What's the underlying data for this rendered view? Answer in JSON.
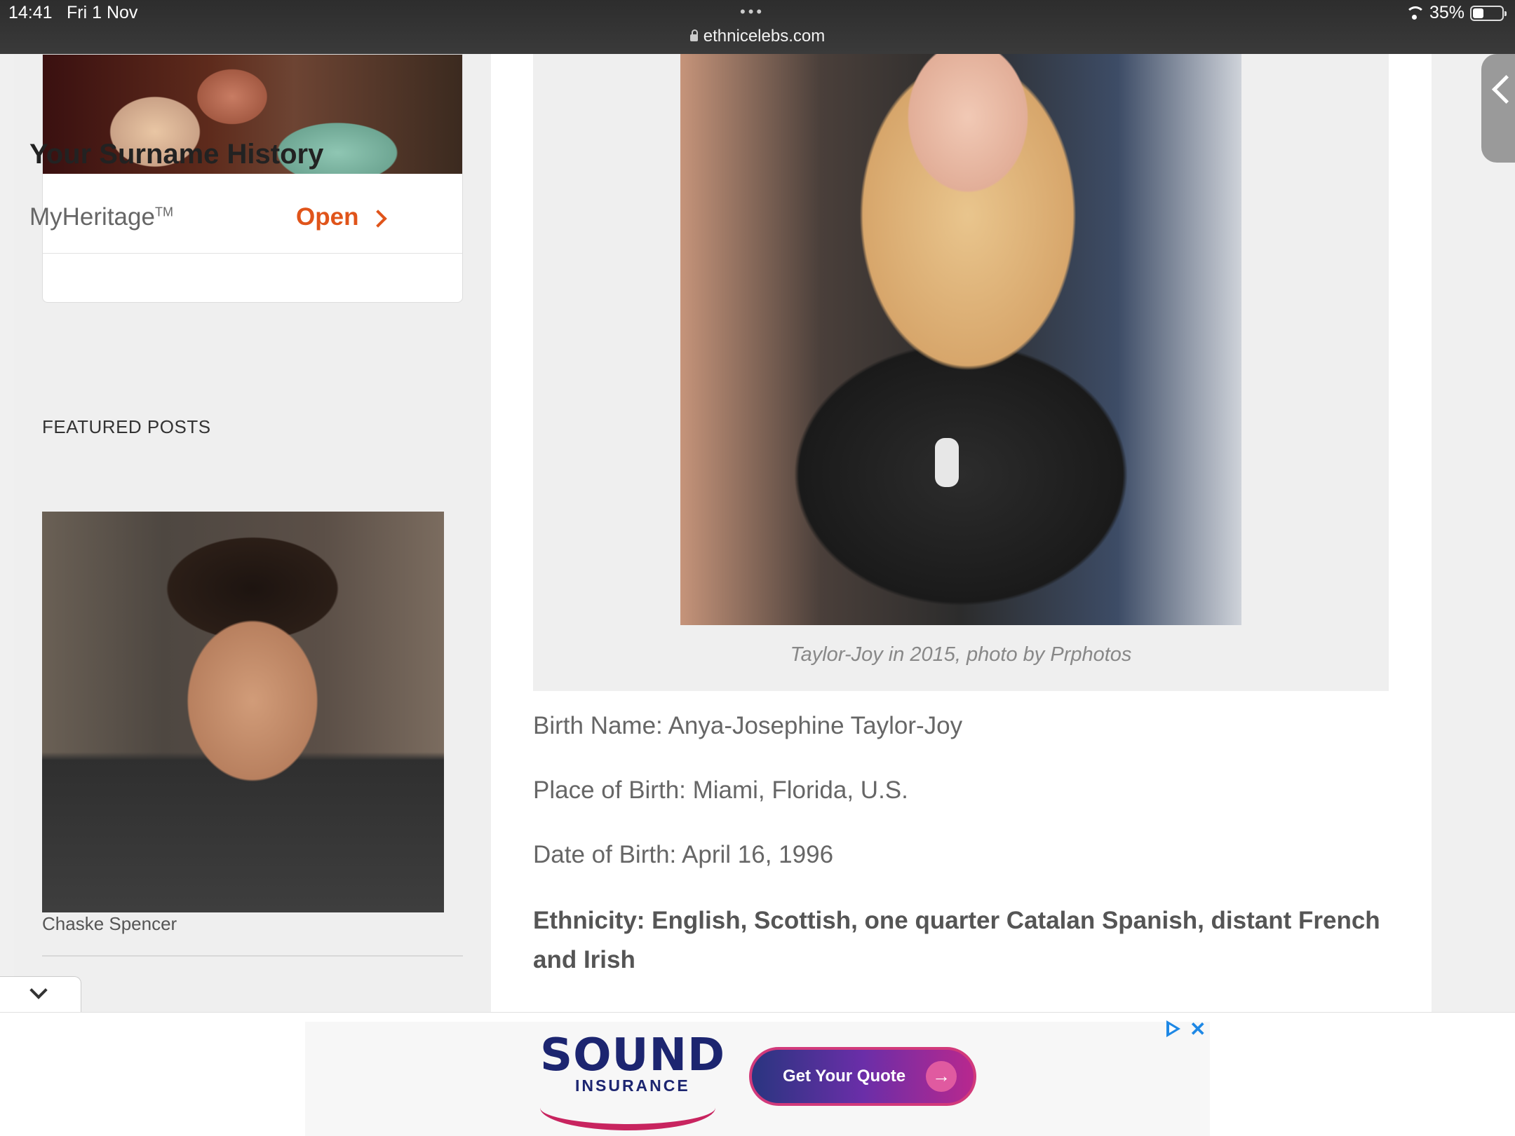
{
  "status_bar": {
    "time": "14:41",
    "date": "Fri 1 Nov",
    "battery": "35%",
    "url": "ethnicelebs.com"
  },
  "sidebar_ad": {
    "headline": "Your Surname History",
    "brand": "MyHeritage",
    "trademark": "TM",
    "cta": "Open"
  },
  "featured": {
    "heading": "FEATURED POSTS",
    "post_caption": "Chaske Spencer"
  },
  "article": {
    "photo_caption": "Taylor-Joy in 2015, photo by Prphotos",
    "birth_name": "Birth Name: Anya-Josephine Taylor-Joy",
    "place_of_birth": "Place of Birth: Miami, Florida, U.S.",
    "date_of_birth": "Date of Birth: April 16, 1996",
    "ethnicity": "Ethnicity: English, Scottish, one quarter Catalan Spanish, distant French and Irish"
  },
  "bottom_ad": {
    "logo_main": "SOUND",
    "logo_sub": "INSURANCE",
    "cta": "Get Your Quote",
    "arrow": "→",
    "close": "✕"
  },
  "colors": {
    "accent_orange": "#e0541a",
    "ad_navy": "#1c2570",
    "ad_pink": "#c8245f",
    "ad_choices_blue": "#1e88e5"
  },
  "icons": [
    "lock-icon",
    "wifi-icon",
    "battery-icon",
    "chevron-right-icon",
    "chevron-down-icon",
    "chevron-left-icon",
    "adchoices-icon",
    "close-icon"
  ]
}
